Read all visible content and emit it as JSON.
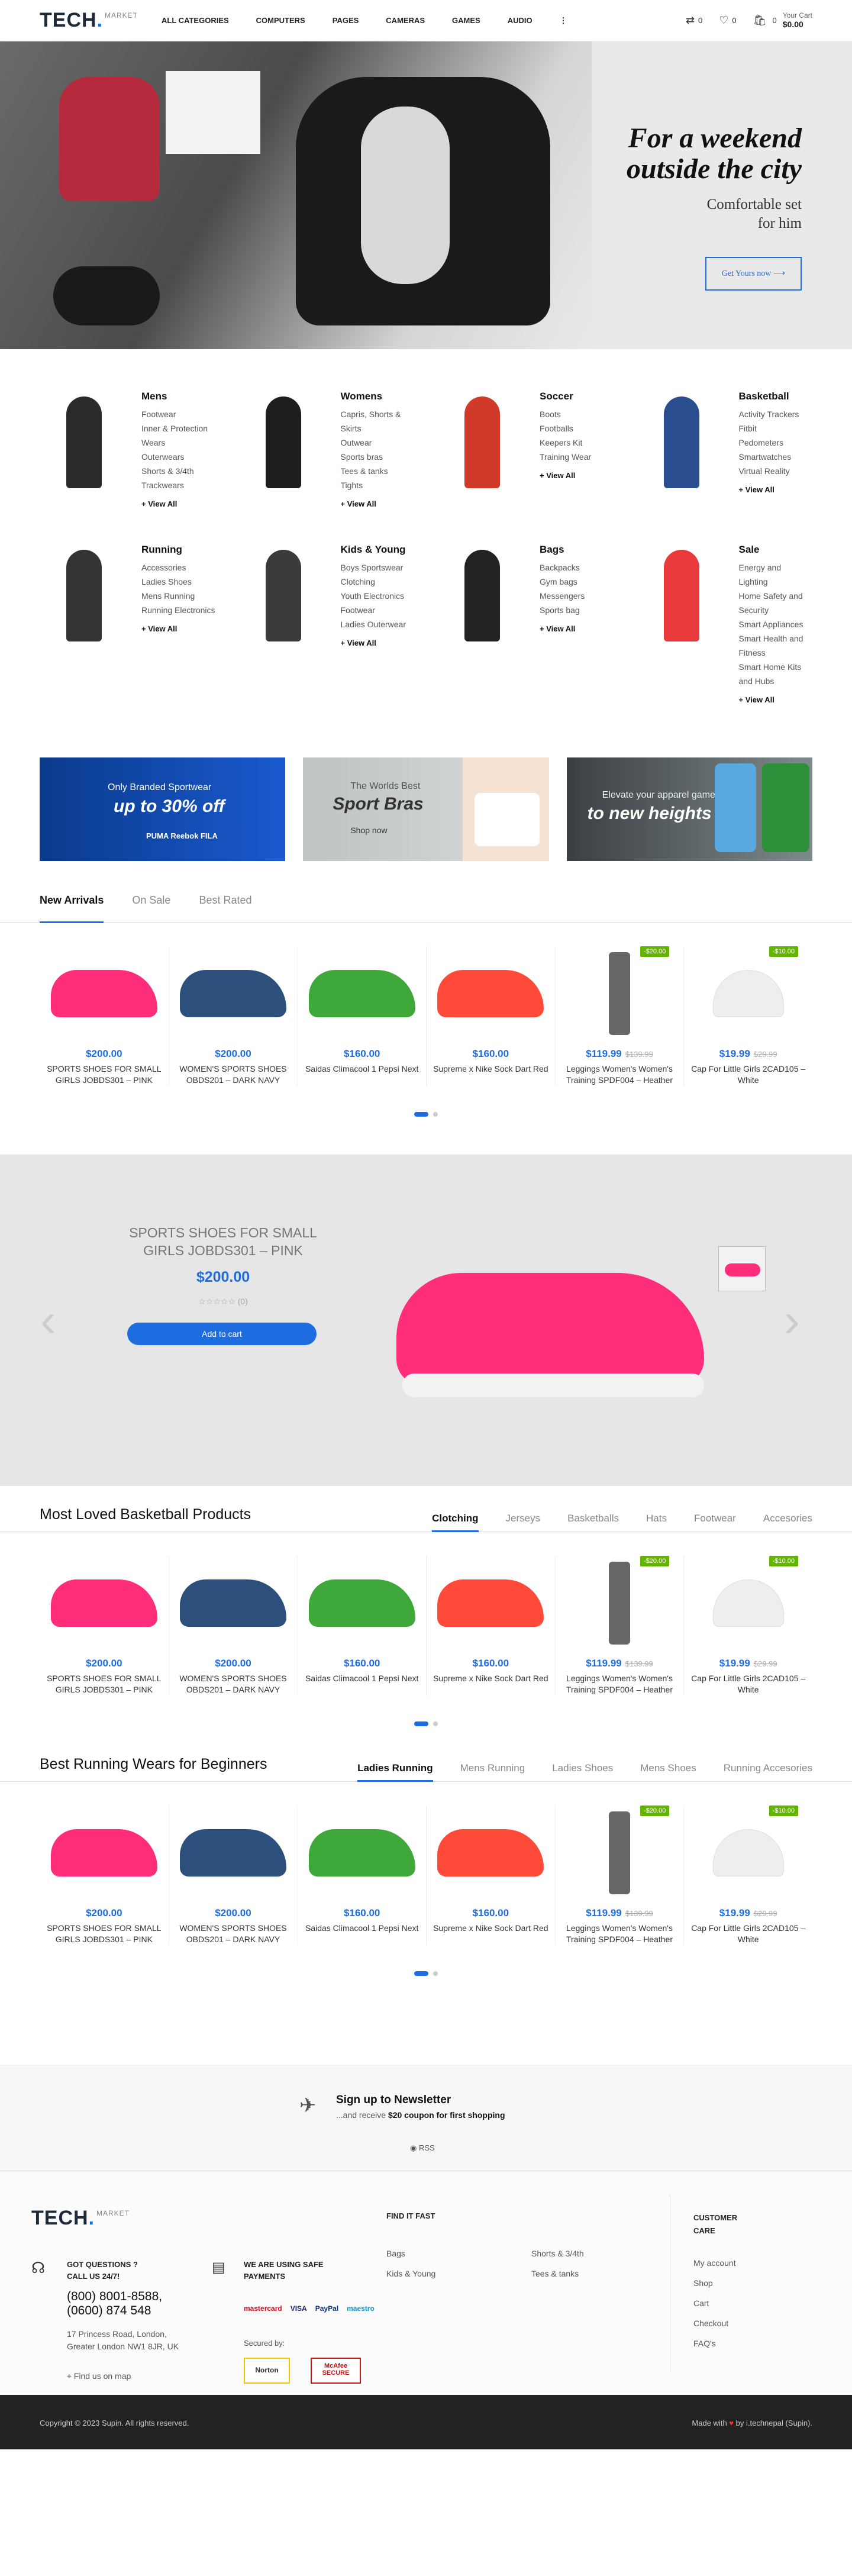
{
  "header": {
    "logo_main": "TECH",
    "logo_sub": "MARKET",
    "nav": [
      "ALL CATEGORIES",
      "COMPUTERS",
      "PAGES",
      "CAMERAS",
      "GAMES",
      "AUDIO"
    ],
    "more_icon": "more-vertical-icon",
    "compare_count": "0",
    "wishlist_count": "0",
    "cart_count": "0",
    "cart_label": "Your Cart",
    "cart_total": "$0.00"
  },
  "hero": {
    "line1": "For a weekend",
    "line2": "outside the city",
    "sub1": "Comfortable set",
    "sub2": "for him",
    "button": "Get Yours now"
  },
  "categories": [
    {
      "title": "Mens",
      "items": [
        "Footwear",
        "Inner & Protection Wears",
        "Outerwears",
        "Shorts & 3/4th",
        "Trackwears"
      ],
      "view_all": "+ View All",
      "color": "#2a2a2a"
    },
    {
      "title": "Womens",
      "items": [
        "Capris, Shorts & Skirts",
        "Outwear",
        "Sports bras",
        "Tees & tanks",
        "Tights"
      ],
      "view_all": "+ View All",
      "color": "#1e1e1e"
    },
    {
      "title": "Soccer",
      "items": [
        "Boots",
        "Footballs",
        "Keepers Kit",
        "Training Wear"
      ],
      "view_all": "+ View All",
      "color": "#d03a2a"
    },
    {
      "title": "Basketball",
      "items": [
        "Activity Trackers",
        "Fitbit",
        "Pedometers",
        "Smartwatches",
        "Virtual Reality"
      ],
      "view_all": "+ View All",
      "color": "#2a4d8f"
    },
    {
      "title": "Running",
      "items": [
        "Accessories",
        "Ladies Shoes",
        "Mens Running",
        "Running Electronics"
      ],
      "view_all": "+ View All",
      "color": "#333"
    },
    {
      "title": "Kids & Young",
      "items": [
        "Boys Sportswear",
        "Clotching",
        "Youth Electronics",
        "Footwear",
        "Ladies Outerwear"
      ],
      "view_all": "+ View All",
      "color": "#3a3a3a"
    },
    {
      "title": "Bags",
      "items": [
        "Backpacks",
        "Gym bags",
        "Messengers",
        "Sports bag"
      ],
      "view_all": "+ View All",
      "color": "#222"
    },
    {
      "title": "Sale",
      "items": [
        "Energy and Lighting",
        "Home Safety and Security",
        "Smart Appliances",
        "Smart Health and Fitness",
        "Smart Home Kits and Hubs"
      ],
      "view_all": "+ View All",
      "color": "#e83a3a"
    }
  ],
  "banners": [
    {
      "line1": "Only Branded Sportwear",
      "line2": "up to 30% off",
      "brands": "PUMA  Reebok  FILA"
    },
    {
      "line1": "The Worlds Best",
      "line2": "Sport Bras",
      "cta": "Shop now"
    },
    {
      "line1": "Elevate your apparel game",
      "line2": "to new heights"
    }
  ],
  "tabs": [
    "New Arrivals",
    "On Sale",
    "Best Rated"
  ],
  "products": [
    {
      "price": "$200.00",
      "old": "",
      "name": "SPORTS SHOES FOR SMALL GIRLS JOBDS301 – PINK",
      "badge": "",
      "color": "#ff2d7a"
    },
    {
      "price": "$200.00",
      "old": "",
      "name": "WOMEN'S SPORTS SHOES OBDS201 – DARK NAVY",
      "badge": "",
      "color": "#2c4f7c"
    },
    {
      "price": "$160.00",
      "old": "",
      "name": "Saidas Climacool 1 Pepsi Next",
      "badge": "",
      "color": "#3fa83a"
    },
    {
      "price": "$160.00",
      "old": "",
      "name": "Supreme x Nike Sock Dart Red",
      "badge": "",
      "color": "#ff4a3a"
    },
    {
      "price": "$119.99",
      "old": "$139.99",
      "name": "Leggings Women's Women's Training SPDF004 – Heather",
      "badge": "-$20.00",
      "color": "#666"
    },
    {
      "price": "$19.99",
      "old": "$29.99",
      "name": "Cap For Little Girls 2CAD105 – White",
      "badge": "-$10.00",
      "color": "#eee"
    }
  ],
  "featured": {
    "name": "SPORTS SHOES FOR SMALL GIRLS JOBDS301 – PINK",
    "price": "$200.00",
    "reviews": "(0)",
    "button": "Add to cart"
  },
  "section2": {
    "title": "Most Loved Basketball Products",
    "tabs": [
      "Clotching",
      "Jerseys",
      "Basketballs",
      "Hats",
      "Footwear",
      "Accesories"
    ]
  },
  "section3": {
    "title": "Best Running Wears for Beginners",
    "tabs": [
      "Ladies Running",
      "Mens Running",
      "Ladies Shoes",
      "Mens Shoes",
      "Running Accesories"
    ]
  },
  "newsletter": {
    "title": "Sign up to Newsletter",
    "sub_pre": "...and receive ",
    "sub_bold": "$20 coupon for first shopping",
    "rss": "RSS"
  },
  "footer": {
    "questions": "GOT QUESTIONS ? CALL US 24/7!",
    "phone1": "(800) 8001-8588,",
    "phone2": "(0600) 874 548",
    "address": "17 Princess Road, London, Greater London NW1 8JR, UK",
    "map": "Find us on map",
    "payments": "WE ARE USING SAFE PAYMENTS",
    "pay_icons": [
      "mastercard",
      "VISA",
      "PayPal",
      "maestro"
    ],
    "secured": "Secured by:",
    "norton": "Norton",
    "mcafee": "McAfee SECURE",
    "find_fast": "FIND IT FAST",
    "links_col1": [
      "Bags",
      "Kids & Young"
    ],
    "links_col2": [
      "Shorts & 3/4th",
      "Tees & tanks"
    ],
    "care_title": "CUSTOMER CARE",
    "care": [
      "My account",
      "Shop",
      "Cart",
      "Checkout",
      "FAQ's"
    ]
  },
  "bottom": {
    "copyright": "Copyright © 2023 Supin. All rights reserved.",
    "made_pre": "Made with",
    "made_post": "by i.technepal (Supin)."
  }
}
